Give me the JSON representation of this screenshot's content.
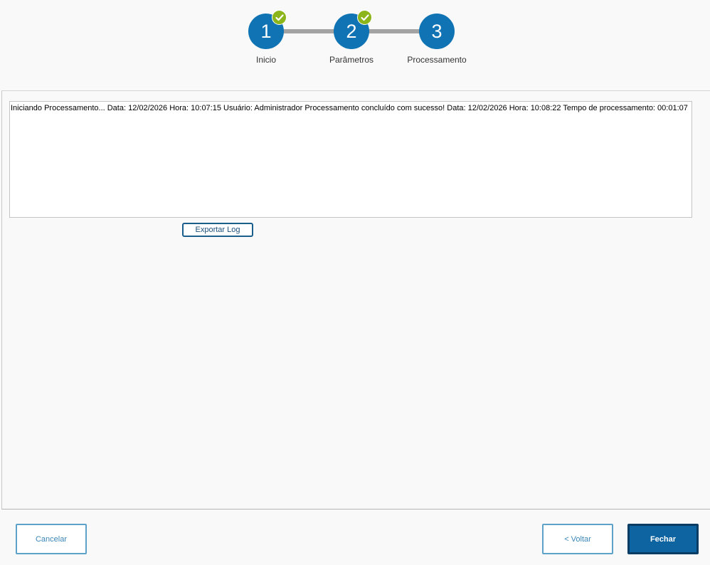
{
  "stepper": {
    "steps": [
      {
        "number": "1",
        "label": "Inicio",
        "completed": true
      },
      {
        "number": "2",
        "label": "Parâmetros",
        "completed": true
      },
      {
        "number": "3",
        "label": "Processamento",
        "completed": false
      }
    ]
  },
  "log": {
    "text": "Iniciando Processamento... Data: 12/02/2026 Hora: 10:07:15 Usuário: Administrador Processamento concluído com sucesso! Data: 12/02/2026 Hora: 10:08:22 Tempo de processamento: 00:01:07",
    "export_label": "Exportar Log"
  },
  "footer": {
    "cancel_label": "Cancelar",
    "back_label": "< Voltar",
    "close_label": "Fechar"
  },
  "colors": {
    "step_circle": "#0f73b4",
    "check_badge": "#8bb51a",
    "primary_button": "#0d64a0"
  },
  "icons": {
    "step_complete": "check-icon"
  }
}
